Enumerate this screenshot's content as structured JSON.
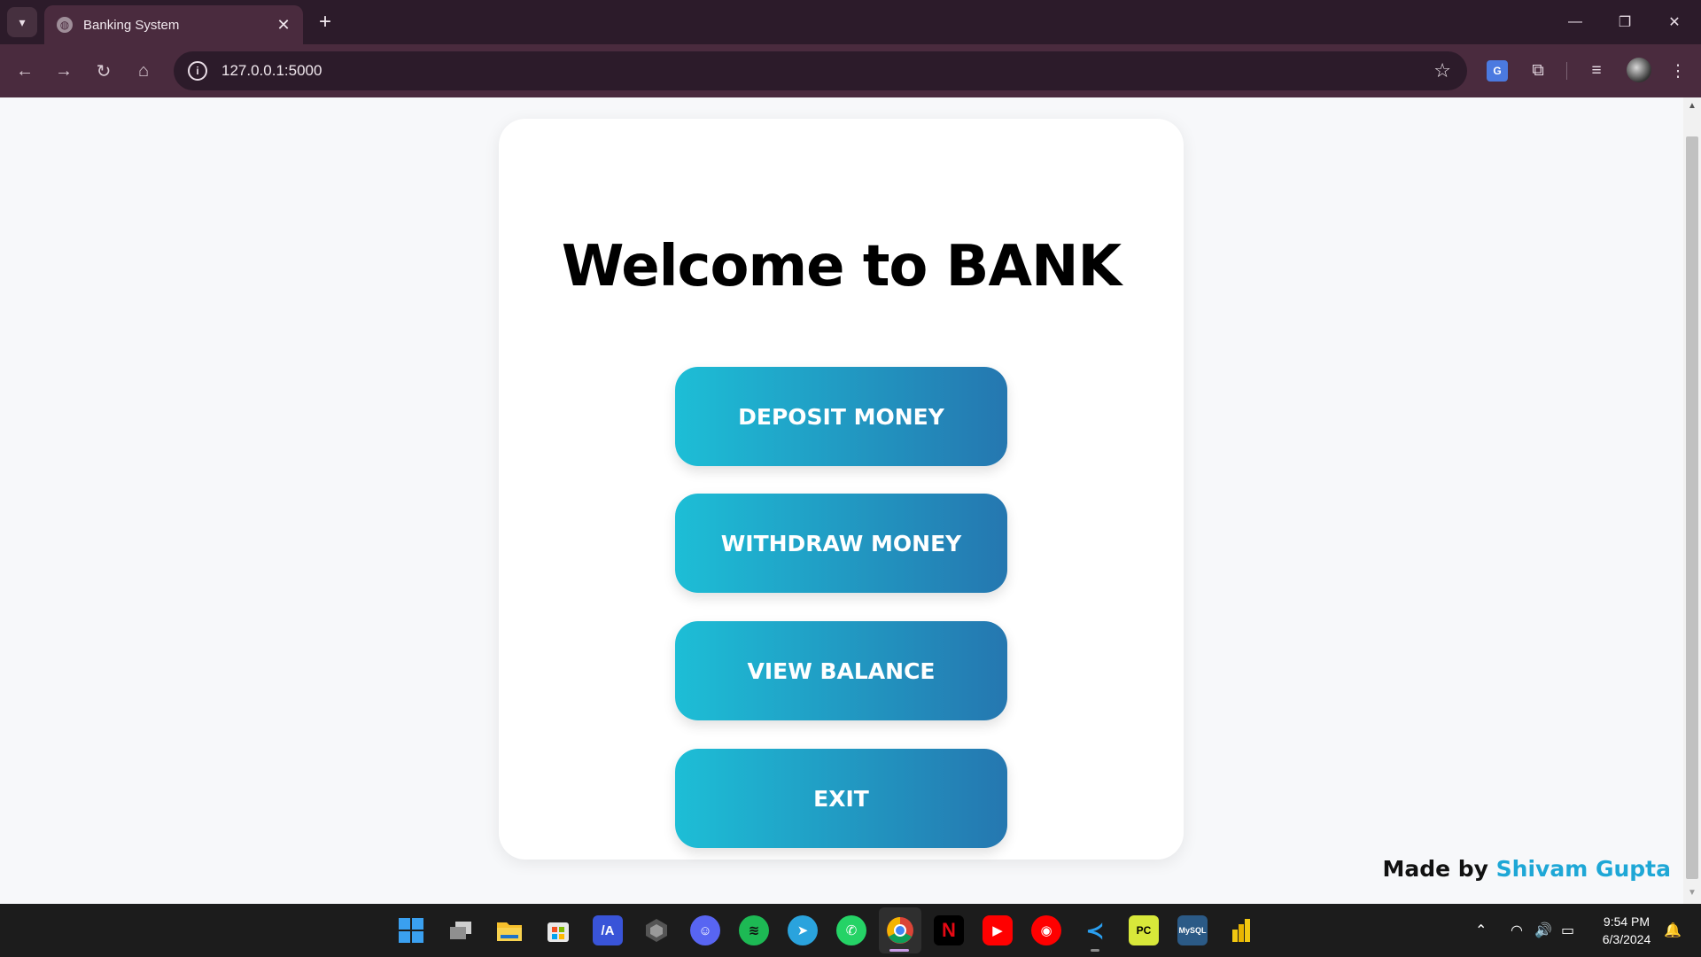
{
  "browser": {
    "tab_title": "Banking System",
    "tab_close": "✕",
    "new_tab": "+",
    "url": "127.0.0.1:5000"
  },
  "page": {
    "heading": "Welcome to BANK",
    "buttons": [
      {
        "label": "DEPOSIT MONEY"
      },
      {
        "label": "WITHDRAW MONEY"
      },
      {
        "label": "VIEW BALANCE"
      },
      {
        "label": "EXIT"
      }
    ],
    "footer": {
      "made_by": "Made by ",
      "author": "Shivam Gupta"
    },
    "colors": {
      "button_gradient_start": "#1dbed6",
      "button_gradient_end": "#2577b0",
      "author_accent": "#1ea7d6"
    }
  },
  "taskbar": {
    "apps": [
      "windows-start",
      "task-view",
      "file-explorer",
      "microsoft-store",
      "code-editor",
      "unity",
      "discord",
      "spotify",
      "telegram",
      "whatsapp",
      "chrome",
      "netflix",
      "youtube",
      "youtube-music",
      "vscode",
      "pycharm",
      "mysql-workbench",
      "power-bi"
    ],
    "time": "9:54 PM",
    "date": "6/3/2024"
  }
}
